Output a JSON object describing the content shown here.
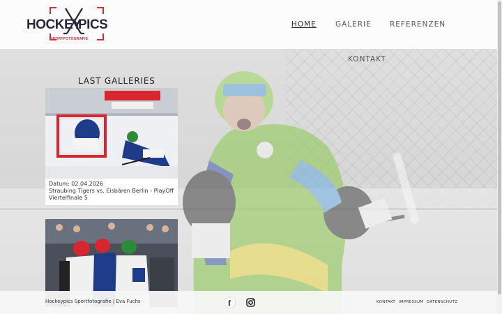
{
  "logo": {
    "left": "HOCKEY",
    "right": "PICS",
    "subtitle": "SPORTFOTOGRAFIE"
  },
  "nav": {
    "home": "HOME",
    "galerie": "GALERIE",
    "referenzen": "REFERENZEN",
    "kontakt": "KONTAKT"
  },
  "galleries": {
    "title": "LAST GALLERIES",
    "items": [
      {
        "date": "Datum: 02.04.2026",
        "title": "Straubing Tigers vs. Eisbären Berlin - PlayOff Viertelfinale 5"
      }
    ]
  },
  "footer": {
    "copyright": "Hockeypics Sportfotografie | Eva Fuchs",
    "links": {
      "kontakt": "KONTAKT",
      "impressum": "IMPRESSUM",
      "datenschutz": "DATENSCHUTZ"
    },
    "social": [
      "facebook-icon",
      "instagram-icon"
    ]
  },
  "colors": {
    "accent": "#d42e38",
    "navy": "#27293a",
    "jersey_green": "#7cbf3a"
  }
}
